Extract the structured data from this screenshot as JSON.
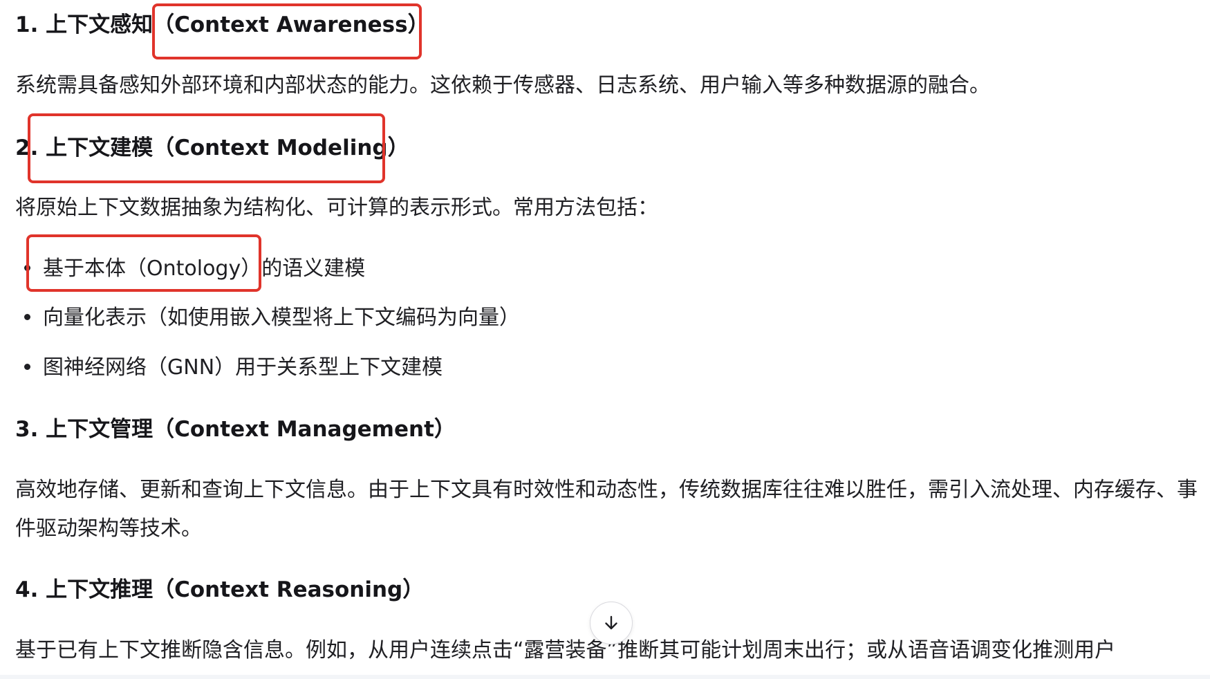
{
  "sections": {
    "s1_heading": "1. 上下文感知（Context Awareness）",
    "s1_para": "系统需具备感知外部环境和内部状态的能力。这依赖于传感器、日志系统、用户输入等多种数据源的融合。",
    "s2_heading": "2. 上下文建模（Context Modeling）",
    "s2_para": "将原始上下文数据抽象为结构化、可计算的表示形式。常用方法包括：",
    "s2_bullets": [
      "基于本体（Ontology）的语义建模",
      "向量化表示（如使用嵌入模型将上下文编码为向量）",
      "图神经网络（GNN）用于关系型上下文建模"
    ],
    "s3_heading": "3. 上下文管理（Context Management）",
    "s3_para": "高效地存储、更新和查询上下文信息。由于上下文具有时效性和动态性，传统数据库往往难以胜任，需引入流处理、内存缓存、事件驱动架构等技术。",
    "s4_heading": "4. 上下文推理（Context Reasoning）",
    "s4_para": "基于已有上下文推断隐含信息。例如，从用户连续点击“露营装备”推断其可能计划周末出行；或从语音语调变化推测用户"
  },
  "scroll_button": {
    "icon": "arrow-down-icon"
  },
  "colors": {
    "highlight_box": "#e0342b",
    "text": "#1f1f23"
  }
}
